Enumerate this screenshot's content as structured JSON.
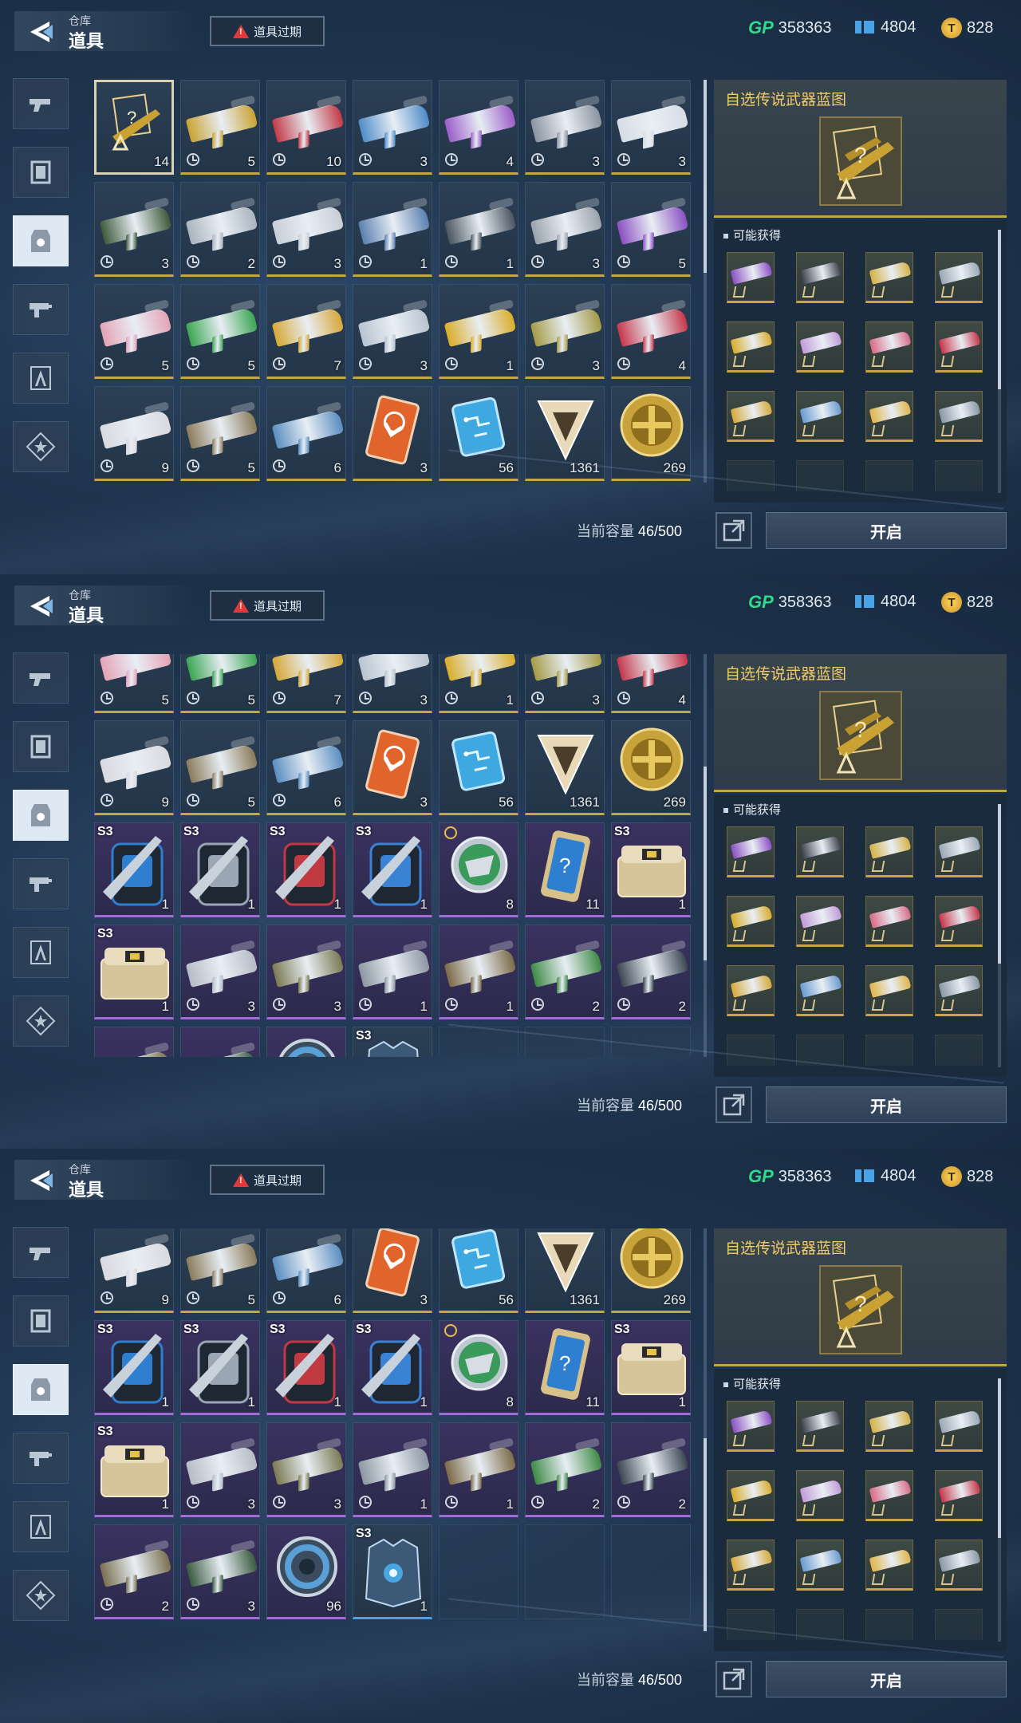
{
  "header": {
    "breadcrumb": "仓库",
    "title": "道具",
    "expire_label": "道具过期",
    "currencies": [
      {
        "icon": "gp-icon",
        "label": "GP",
        "value": "358363"
      },
      {
        "icon": "ticket-icon",
        "value": "4804"
      },
      {
        "icon": "gold-coin-icon",
        "value": "828"
      }
    ]
  },
  "sidebar": {
    "tabs": [
      {
        "icon": "pistol-icon",
        "active": false
      },
      {
        "icon": "frame-icon",
        "active": false
      },
      {
        "icon": "tag-icon",
        "active": true
      },
      {
        "icon": "rifle-part-icon",
        "active": false
      },
      {
        "icon": "compass-icon",
        "active": false
      },
      {
        "icon": "star-badge-icon",
        "active": false
      }
    ]
  },
  "inventory": {
    "items": [
      {
        "kind": "blueprint",
        "count": "14",
        "rarity": "gold",
        "selected": true
      },
      {
        "kind": "gun",
        "color": "#c9a233",
        "count": "5",
        "timed": true
      },
      {
        "kind": "gun",
        "color": "#c23a46",
        "count": "10",
        "timed": true
      },
      {
        "kind": "gun",
        "color": "#4d8cc9",
        "count": "3",
        "timed": true
      },
      {
        "kind": "gun",
        "color": "#9a5cc8",
        "count": "4",
        "timed": true
      },
      {
        "kind": "gun",
        "color": "#8a93a0",
        "count": "3",
        "timed": true
      },
      {
        "kind": "gun",
        "color": "#d6dde4",
        "count": "3",
        "timed": true
      },
      {
        "kind": "gun",
        "color": "#3d5a3a",
        "count": "3",
        "timed": true
      },
      {
        "kind": "gun",
        "color": "#aab4be",
        "count": "2",
        "timed": true
      },
      {
        "kind": "gun",
        "color": "#c8ced6",
        "count": "3",
        "timed": true
      },
      {
        "kind": "gun",
        "color": "#5a7fb0",
        "count": "1",
        "timed": true
      },
      {
        "kind": "gun",
        "color": "#4a5560",
        "count": "1",
        "timed": true
      },
      {
        "kind": "gun",
        "color": "#9aa2ac",
        "count": "3",
        "timed": true
      },
      {
        "kind": "gun",
        "color": "#8a4fc2",
        "count": "5",
        "timed": true
      },
      {
        "kind": "gun",
        "color": "#e4a3b5",
        "count": "5",
        "timed": true
      },
      {
        "kind": "gun",
        "color": "#3aa552",
        "count": "5",
        "timed": true
      },
      {
        "kind": "gun",
        "color": "#d6a837",
        "count": "7",
        "timed": true
      },
      {
        "kind": "gun",
        "color": "#b9c4d0",
        "count": "3",
        "timed": true
      },
      {
        "kind": "gun",
        "color": "#d9ad2a",
        "count": "1",
        "timed": true
      },
      {
        "kind": "gun",
        "color": "#a49a46",
        "count": "3",
        "timed": true
      },
      {
        "kind": "gun",
        "color": "#c6364a",
        "count": "4",
        "timed": true
      },
      {
        "kind": "gun",
        "color": "#d9d9de",
        "count": "9",
        "timed": true
      },
      {
        "kind": "gun",
        "color": "#8a7a5a",
        "count": "5",
        "timed": true
      },
      {
        "kind": "gun",
        "color": "#5a8ec0",
        "count": "6",
        "timed": true
      },
      {
        "kind": "card",
        "color": "#e0642c",
        "count": "3"
      },
      {
        "kind": "chip",
        "color": "#3fa8e0",
        "count": "56"
      },
      {
        "kind": "triangle",
        "color": "#e8d9b8",
        "count": "1361"
      },
      {
        "kind": "medal",
        "color": "#c8a23a",
        "count": "269"
      },
      {
        "kind": "backpack",
        "color": "#2f7fd0",
        "count": "1",
        "s3": "S3",
        "rarity": "purple"
      },
      {
        "kind": "backpack",
        "color": "#9aa6b4",
        "count": "1",
        "s3": "S3",
        "rarity": "purple"
      },
      {
        "kind": "backpack",
        "color": "#c03a42",
        "count": "1",
        "s3": "S3",
        "rarity": "purple"
      },
      {
        "kind": "backpack",
        "color": "#3a82d4",
        "count": "1",
        "s3": "S3",
        "rarity": "purple"
      },
      {
        "kind": "badge",
        "color": "#3a9a5a",
        "count": "8",
        "timedTop": true,
        "rarity": "purple"
      },
      {
        "kind": "phone",
        "color": "#2f7fd0",
        "count": "11",
        "rarity": "purple"
      },
      {
        "kind": "chest",
        "color": "#d6c49a",
        "count": "1",
        "s3": "S3",
        "rarity": "purple"
      },
      {
        "kind": "chest",
        "color": "#d6c49a",
        "count": "1",
        "s3": "S3",
        "rarity": "purple"
      },
      {
        "kind": "gun",
        "color": "#b5bcc6",
        "count": "3",
        "timed": true,
        "rarity": "purple"
      },
      {
        "kind": "gun",
        "color": "#7a7a52",
        "count": "3",
        "timed": true,
        "rarity": "purple"
      },
      {
        "kind": "gun",
        "color": "#8c96a2",
        "count": "1",
        "timed": true,
        "rarity": "purple"
      },
      {
        "kind": "gun",
        "color": "#7b6a48",
        "count": "1",
        "timed": true,
        "rarity": "purple"
      },
      {
        "kind": "gun",
        "color": "#3f8a46",
        "count": "2",
        "timed": true,
        "rarity": "purple"
      },
      {
        "kind": "gun",
        "color": "#3a4652",
        "count": "2",
        "timed": true,
        "rarity": "purple"
      },
      {
        "kind": "gun",
        "color": "#7a7050",
        "count": "2",
        "timed": true,
        "rarity": "purple"
      },
      {
        "kind": "gun",
        "color": "#3a5a40",
        "count": "3",
        "timed": true,
        "rarity": "purple"
      },
      {
        "kind": "ring",
        "color": "#5aa0d8",
        "count": "96",
        "rarity": "purple"
      },
      {
        "kind": "armor",
        "color": "#4aa6e0",
        "count": "1",
        "s3": "S3",
        "rarity": "blue"
      },
      {
        "kind": "empty"
      },
      {
        "kind": "empty"
      },
      {
        "kind": "empty"
      }
    ],
    "capacity_label": "当前容量",
    "capacity_value": "46/500"
  },
  "detail": {
    "title": "自选传说武器蓝图",
    "possible_label": "可能获得",
    "rewards": [
      {
        "color": "#8a4fc2"
      },
      {
        "color": "#3a3f48"
      },
      {
        "color": "#d6b046"
      },
      {
        "color": "#9aa6b4"
      },
      {
        "color": "#d9ad2a"
      },
      {
        "color": "#c29ad8"
      },
      {
        "color": "#d86a86"
      },
      {
        "color": "#c6364a"
      },
      {
        "color": "#d6a837"
      },
      {
        "color": "#6a9ad0"
      },
      {
        "color": "#e0b44a"
      },
      {
        "color": "#8a96a4"
      }
    ],
    "open_label": "开启"
  },
  "views": [
    {
      "scroll_rows": 0,
      "thumb_offset": 0.0,
      "thumb_size": 0.48
    },
    {
      "scroll_rows": 2.35,
      "thumb_offset": 0.28,
      "thumb_size": 0.48
    },
    {
      "scroll_rows": 3.1,
      "thumb_offset": 0.52,
      "thumb_size": 0.48
    }
  ]
}
